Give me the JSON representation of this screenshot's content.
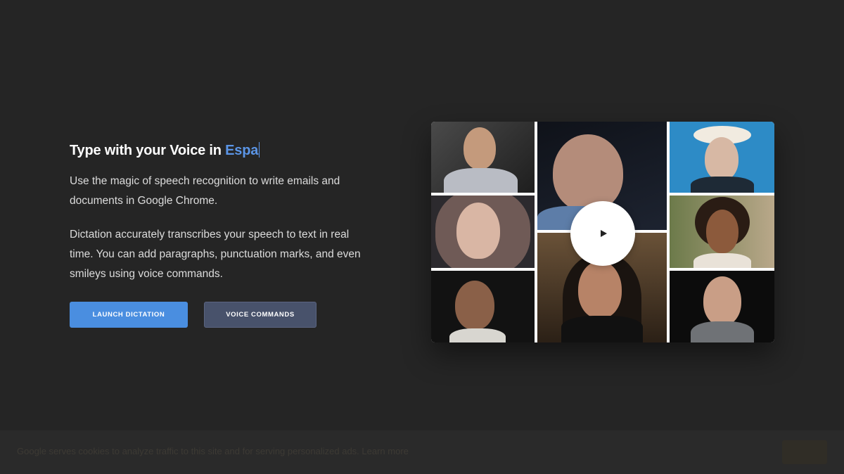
{
  "hero": {
    "headline_prefix": "Type with your Voice in ",
    "headline_typed": "Espa",
    "paragraph1": "Use the magic of speech recognition to write emails and documents in Google Chrome.",
    "paragraph2": "Dictation accurately transcribes your speech to text in real time. You can add paragraphs, punctuation marks, and even smileys using voice commands."
  },
  "buttons": {
    "launch_label": "LAUNCH DICTATION",
    "voice_label": "VOICE COMMANDS"
  },
  "video": {
    "play_icon": "play-icon"
  },
  "cookie": {
    "text": "Google serves cookies to analyze traffic to this site and for serving personalized ads. Learn more",
    "button_label": ""
  },
  "colors": {
    "background": "#252525",
    "accent": "#4a8ee0",
    "typed_text": "#5b95e6",
    "secondary_button": "#48526b"
  }
}
